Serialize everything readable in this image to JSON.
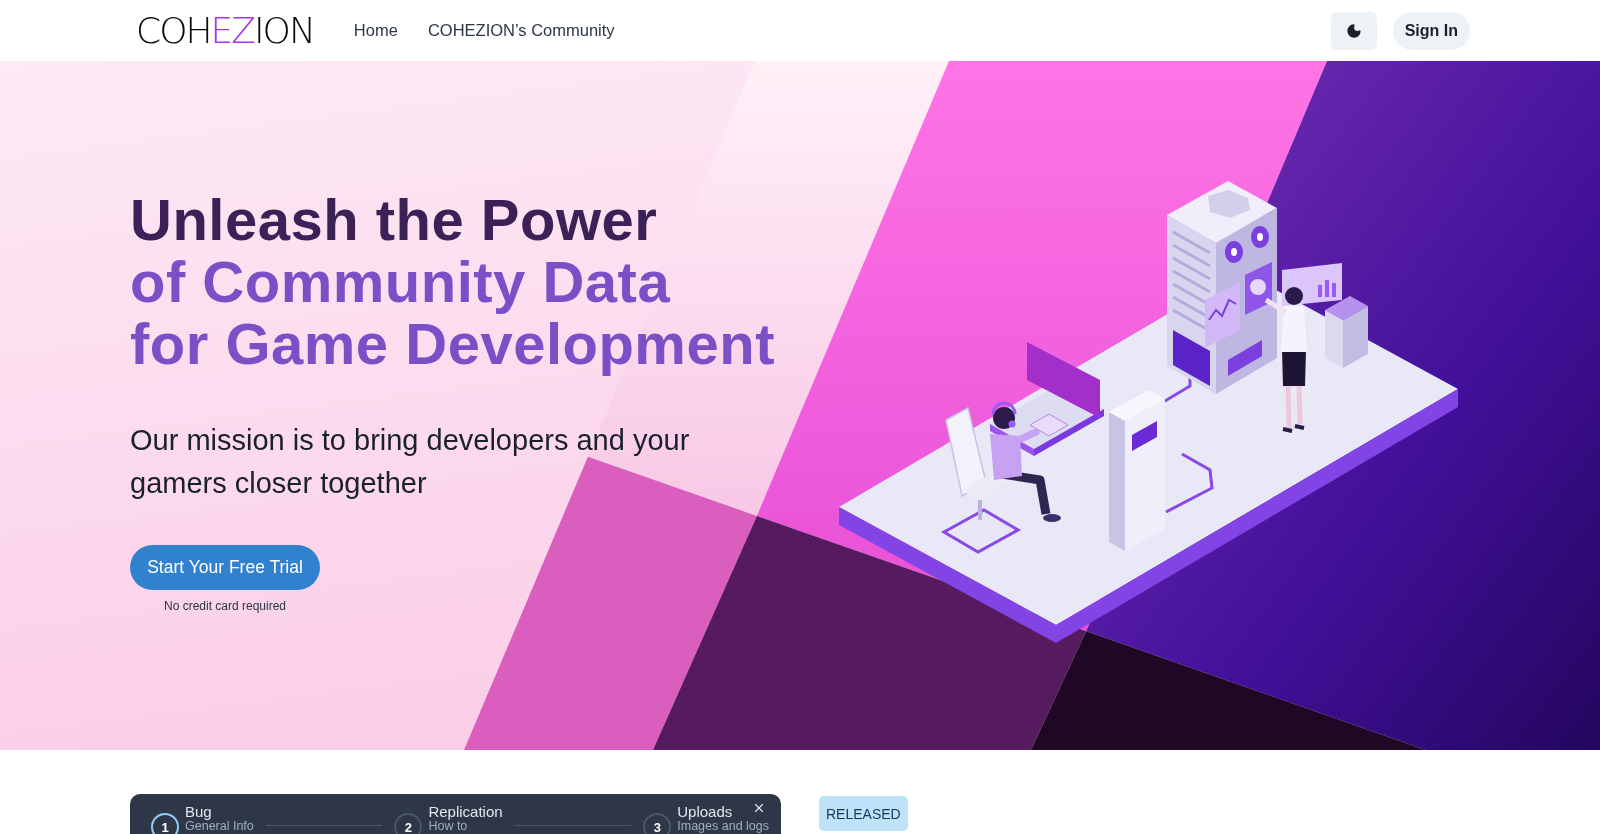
{
  "header": {
    "logo": {
      "start": "COH",
      "accent": "EZ",
      "end": "ION"
    },
    "nav": [
      {
        "label": "Home"
      },
      {
        "label": "COHEZION’s Community"
      }
    ],
    "sign_in": "Sign In"
  },
  "hero": {
    "headline": [
      {
        "text": "Unleash the Power",
        "accent": false
      },
      {
        "text": "of Community Data",
        "accent": true
      },
      {
        "text": "for Game Development",
        "accent": true
      }
    ],
    "subtitle": "Our mission is to bring developers and your gamers closer together",
    "cta": "Start Your Free Trial",
    "cta_note": "No credit card required"
  },
  "wizard": {
    "steps": [
      {
        "number": "1",
        "title": "Bug",
        "subtitle": "General Info",
        "selected": true
      },
      {
        "number": "2",
        "title": "Replication",
        "subtitle": "How to",
        "selected": false
      },
      {
        "number": "3",
        "title": "Uploads",
        "subtitle": "Images and logs",
        "selected": false
      }
    ]
  },
  "badge": "RELEASED"
}
